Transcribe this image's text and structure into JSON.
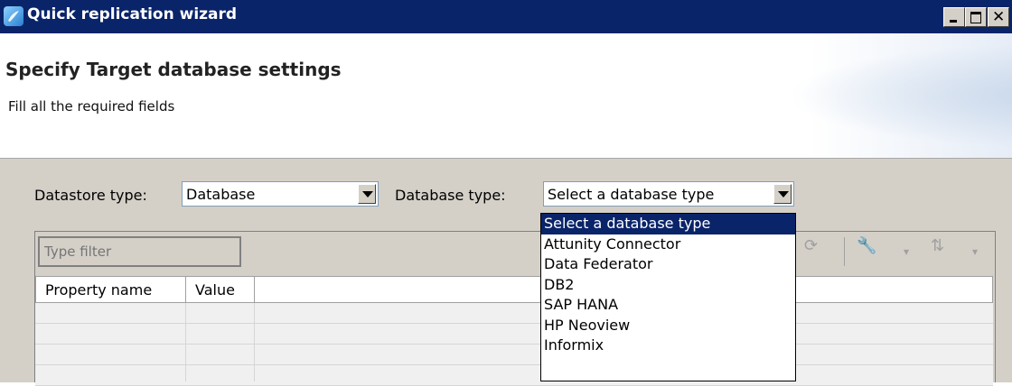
{
  "window": {
    "title": "Quick replication wizard"
  },
  "header": {
    "heading_prefix": "Specify",
    "heading_main": "Target database settings",
    "subtitle": "Fill all the required fields"
  },
  "form": {
    "datastore_label": "Datastore type:",
    "datastore_value": "Database",
    "dbtype_label": "Database type:",
    "dbtype_value": "Select a database type"
  },
  "filter": {
    "placeholder": "Type filter"
  },
  "table": {
    "columns": [
      "Property name",
      "Value"
    ]
  },
  "dropdown": {
    "options": [
      "Select a database type",
      "Attunity Connector",
      "Data Federator",
      "DB2",
      "SAP HANA",
      "HP Neoview",
      "Informix"
    ],
    "selected_index": 0
  },
  "colors": {
    "titlebar": "#0a246a",
    "selection": "#0a246a",
    "panel": "#d4d0c8"
  }
}
